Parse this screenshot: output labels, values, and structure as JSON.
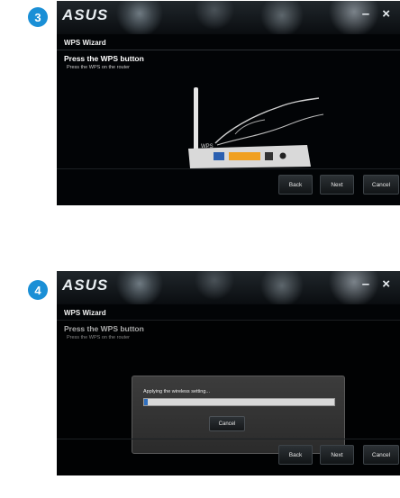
{
  "steps": [
    {
      "number": "3",
      "logo": "ASUS",
      "window_controls": "– ×",
      "wizard_title": "WPS Wizard",
      "heading": "Press the WPS button",
      "subtext": "Press the WPS on the router",
      "wps_label": "WPS",
      "buttons": {
        "back": "Back",
        "next": "Next",
        "cancel": "Cancel"
      }
    },
    {
      "number": "4",
      "logo": "ASUS",
      "window_controls": "– ×",
      "wizard_title": "WPS Wizard",
      "heading": "Press the WPS button",
      "subtext": "Press the WPS on the router",
      "buttons": {
        "back": "Back",
        "next": "Next",
        "cancel": "Cancel"
      },
      "dialog": {
        "message": "Applying the wireless setting...",
        "progress": 0.02,
        "cancel": "Cancel"
      }
    }
  ],
  "colors": {
    "accent": "#1a8fd6",
    "progress": "#2f6fbf",
    "background": "#020406"
  }
}
